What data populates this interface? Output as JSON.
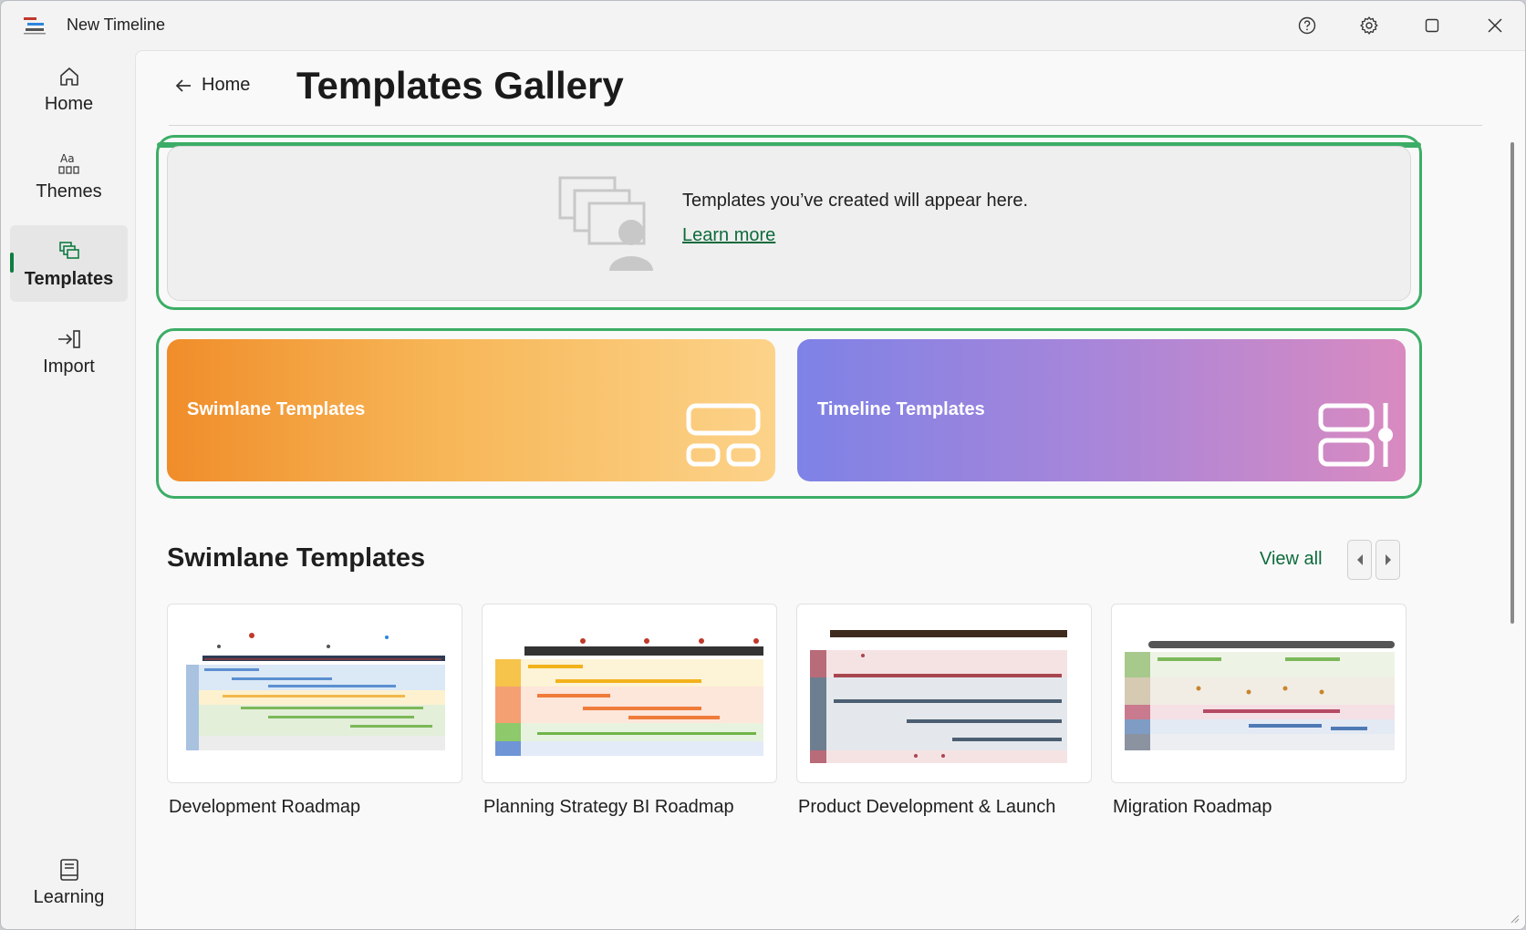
{
  "window": {
    "title": "New Timeline"
  },
  "titlebar": {
    "icons": [
      "help-icon",
      "settings-icon",
      "maximize-icon",
      "close-icon"
    ]
  },
  "sidebar": {
    "items": [
      {
        "label": "Home",
        "icon": "home-icon"
      },
      {
        "label": "Themes",
        "icon": "themes-icon"
      },
      {
        "label": "Templates",
        "icon": "templates-icon",
        "active": true
      },
      {
        "label": "Import",
        "icon": "import-icon"
      },
      {
        "label": "Learning",
        "icon": "learning-icon"
      }
    ]
  },
  "header": {
    "back_label": "Home",
    "title": "Templates Gallery"
  },
  "my_templates": {
    "empty_text": "Templates you’ve created will appear here.",
    "learn_more": "Learn more"
  },
  "banners": [
    {
      "label": "Swimlane Templates",
      "icon": "swimlane-layout-icon"
    },
    {
      "label": "Timeline Templates",
      "icon": "timeline-layout-icon"
    }
  ],
  "section": {
    "title": "Swimlane Templates",
    "view_all": "View all"
  },
  "templates": [
    {
      "name": "Development Roadmap"
    },
    {
      "name": "Planning Strategy BI Roadmap"
    },
    {
      "name": "Product Development & Launch"
    },
    {
      "name": "Migration Roadmap"
    }
  ],
  "colors": {
    "accent_green": "#107c41",
    "frame_green": "#3cad66",
    "link_green": "#0e6b3b",
    "banner_orange": "#f08d2a",
    "banner_purple": "#7e82e6"
  }
}
